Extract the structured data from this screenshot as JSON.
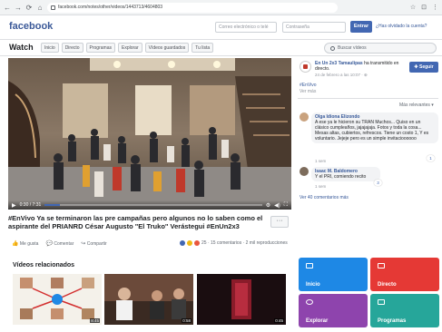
{
  "browser": {
    "url": "facebook.com/notes/other/videos/1443713/4604803",
    "nav": [
      "←",
      "→",
      "⟳",
      "⌂"
    ],
    "tools": [
      "☆",
      "⊡",
      "⋮"
    ]
  },
  "header": {
    "logo": "facebook",
    "email_placeholder": "Correo electrónico o telé",
    "password_placeholder": "Contraseña",
    "login_label": "Entrar",
    "forgot_label": "¿Has olvidado la cuenta?"
  },
  "watch_nav": {
    "title": "Watch",
    "tabs": [
      "Inicio",
      "Directo",
      "Programas",
      "Explorar",
      "Vídeos guardados",
      "Tu lista"
    ],
    "search_placeholder": "Buscar vídeos"
  },
  "video": {
    "time": "0:30 / 7:31",
    "progress": 0.07,
    "title": "#EnVivo Ya se terminaron las pre campañas pero algunos no lo saben como el aspirante del PRIANRD César Augusto \"El Truko\" Verástegui #EnUn2x3",
    "more_label": "···"
  },
  "actions": {
    "like": "Me gusta",
    "comment": "Comentar",
    "share": "Compartir",
    "reactions_text": "25 · 15 comentarios · 2 mil reproducciones"
  },
  "page": {
    "name": "En Un 2x3 Tamaulipas",
    "action": " ha transmitido en directo.",
    "date": "24 de febrero a las 10:07 · ⊕",
    "follow_label": "Seguir",
    "post_tag": "#EnVivo",
    "post_more": "Ver más",
    "relevant_label": "Más relevantes ▾"
  },
  "comments": [
    {
      "author": "Olga Idiona Elizondo",
      "text": "A ese ya le hicieron su TRAN Muchos... Quiso en un clásico cumpleaños, jajajajaja. Fotos y toda la cosa... Mesas altas, cubiertos, refrescos. Tiene un costo 1, Y es voluntario. Jejeje pero es un simple invitacioooooo",
      "time": "1 sem",
      "likes": "1"
    },
    {
      "author": "Isaac M. Baldomero",
      "text": "Y el PRI, comiendo recito",
      "time": "1 sem",
      "likes": "3"
    }
  ],
  "view_more_comments": "Ver 40 comentarios más",
  "related": {
    "title": "Vídeos relacionados",
    "videos": [
      {
        "duration": "8:45"
      },
      {
        "duration": "0:58"
      },
      {
        "duration": "0:45"
      }
    ]
  },
  "tiles": [
    {
      "label": "Inicio",
      "color": "#1e88e5"
    },
    {
      "label": "Directo",
      "color": "#e53935"
    },
    {
      "label": "Explorar",
      "color": "#8e44ad"
    },
    {
      "label": "Programas",
      "color": "#26a69a"
    }
  ]
}
